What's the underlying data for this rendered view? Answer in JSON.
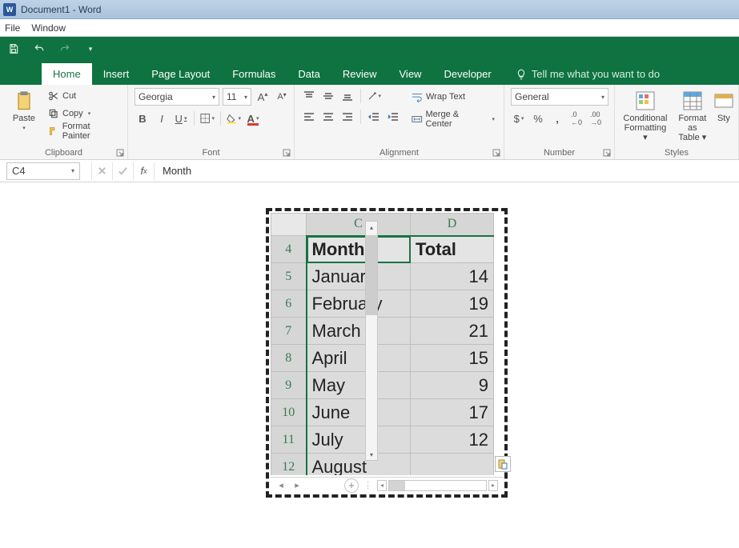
{
  "window": {
    "title": "Document1 - Word"
  },
  "menubar": {
    "file": "File",
    "window": "Window"
  },
  "tabs": {
    "home": "Home",
    "insert": "Insert",
    "pagelayout": "Page Layout",
    "formulas": "Formulas",
    "data": "Data",
    "review": "Review",
    "view": "View",
    "developer": "Developer",
    "tellme": "Tell me what you want to do"
  },
  "clipboard": {
    "paste": "Paste",
    "cut": "Cut",
    "copy": "Copy",
    "fmtpainter": "Format Painter",
    "label": "Clipboard"
  },
  "font": {
    "name": "Georgia",
    "size": "11",
    "label": "Font",
    "bold": "B",
    "italic": "I",
    "underline": "U"
  },
  "alignment": {
    "wrap": "Wrap Text",
    "merge": "Merge & Center",
    "label": "Alignment"
  },
  "number": {
    "format": "General",
    "label": "Number"
  },
  "styles": {
    "cond": "Conditional Formatting",
    "table": "Format as Table",
    "cell": "Sty",
    "label": "Styles"
  },
  "formula_bar": {
    "cellref": "C4",
    "value": "Month"
  },
  "sheet": {
    "columns": [
      "C",
      "D"
    ],
    "rows": [
      {
        "n": 4,
        "month": "Month",
        "total": "Total",
        "header": true
      },
      {
        "n": 5,
        "month": "January",
        "total": 14
      },
      {
        "n": 6,
        "month": "February",
        "total": 19
      },
      {
        "n": 7,
        "month": "March",
        "total": 21
      },
      {
        "n": 8,
        "month": "April",
        "total": 15
      },
      {
        "n": 9,
        "month": "May",
        "total": 9
      },
      {
        "n": 10,
        "month": "June",
        "total": 17
      },
      {
        "n": 11,
        "month": "July",
        "total": 12
      },
      {
        "n": 12,
        "month": "August",
        "total": ""
      }
    ]
  }
}
